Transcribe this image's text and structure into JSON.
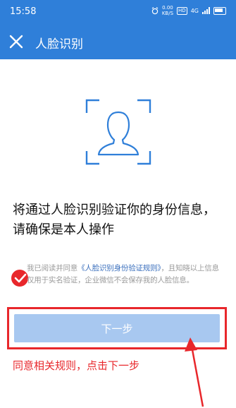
{
  "status_bar": {
    "time": "15:58",
    "net_rate_top": "0.00",
    "net_rate_bottom": "KB/S",
    "badge": "HD",
    "signal": "4G"
  },
  "header": {
    "title": "人脸识别",
    "close_icon": "close-icon"
  },
  "main": {
    "face_icon": "face-scan-icon",
    "headline_line1": "将通过人脸识别验证你的身份信息，",
    "headline_line2": "请确保是本人操作"
  },
  "consent": {
    "checked": true,
    "prefix": "我已阅读并同意",
    "link_text": "《人脸识别身份验证规则》",
    "suffix": "，且知晓以上信息仅用于实名验证，企业微信不会保存我的人脸信息。"
  },
  "actions": {
    "next_label": "下一步"
  },
  "annotation": {
    "text": "同意相关规则，点击下一步"
  },
  "colors": {
    "brand_blue": "#2f7fd9",
    "button_disabled": "#a8c8f0",
    "annotation_red": "#e8272b",
    "link": "#3a6fbd"
  }
}
